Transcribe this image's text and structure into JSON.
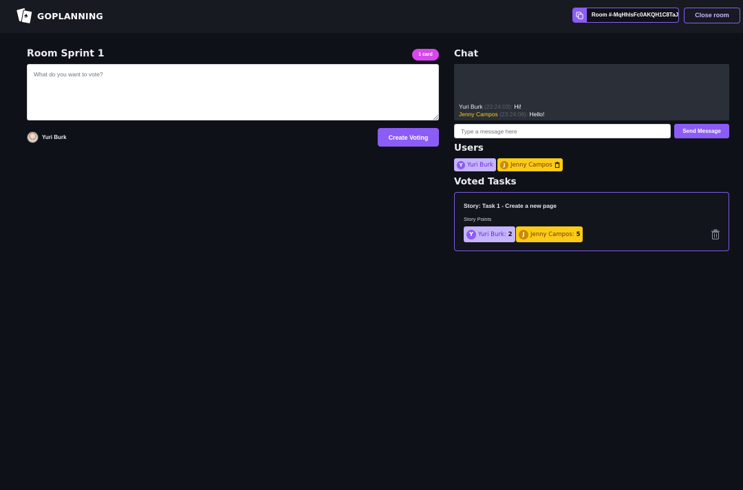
{
  "header": {
    "logo_text": "GOPLANNING",
    "room_code": "Room #-MqHhlsFc0AKQH1C8TaJ",
    "close_room_label": "Close room"
  },
  "room": {
    "title": "Room Sprint 1",
    "card_badge": "1 card",
    "vote_placeholder": "What do you want to vote?",
    "current_user": "Yuri Burk",
    "create_voting_label": "Create Voting"
  },
  "chat": {
    "title": "Chat",
    "messages": [
      {
        "user": "Yuri Burk",
        "time": "(23:24:03):",
        "text": "Hi!"
      },
      {
        "user": "Jenny Campos",
        "time": "(23:24:08):",
        "text": "Hello!"
      }
    ],
    "input_placeholder": "Type a message here",
    "send_label": "Send Message"
  },
  "users": {
    "title": "Users",
    "list": [
      {
        "initial": "Y",
        "name": "Yuri Burk"
      },
      {
        "initial": "J",
        "name": "Jenny Campos"
      }
    ]
  },
  "voted_tasks": {
    "title": "Voted Tasks",
    "tasks": [
      {
        "title": "Story: Task 1 - Create a new page",
        "subtitle": "Story Points",
        "votes": [
          {
            "initial": "Y",
            "name": "Yuri Burk:",
            "score": "2"
          },
          {
            "initial": "J",
            "name": "Jenny Campos:",
            "score": "5"
          }
        ]
      }
    ]
  },
  "colors": {
    "accent": "#8b5cf6",
    "badge": "#d946ef",
    "user_yellow": "#facc15",
    "user_purple": "#c4b5fd"
  },
  "icons": {
    "copy": "copy-icon",
    "trash": "trash-icon",
    "logo": "playing-cards-logo-icon"
  }
}
